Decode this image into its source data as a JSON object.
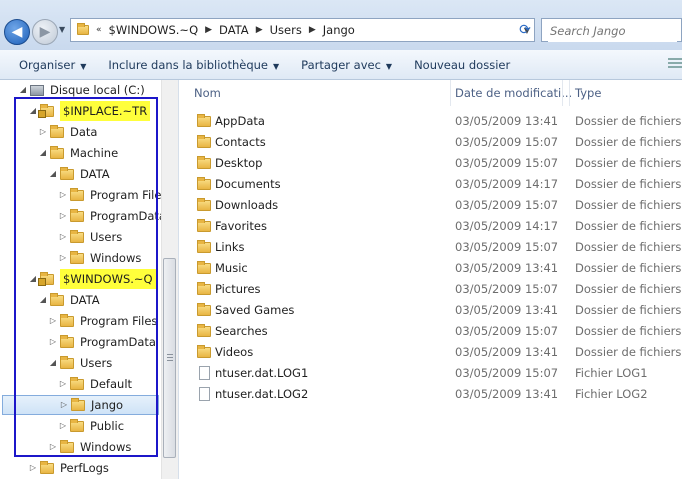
{
  "address": {
    "overflow": "«",
    "crumbs": [
      "$WINDOWS.~Q",
      "DATA",
      "Users",
      "Jango"
    ]
  },
  "search": {
    "placeholder": "Search Jango"
  },
  "toolbar": {
    "organize": "Organiser",
    "library": "Inclure dans la bibliothèque",
    "share": "Partager avec",
    "new_folder": "Nouveau dossier"
  },
  "tree": [
    {
      "label": "Disque local (C:)",
      "kind": "drive",
      "expanded": true
    },
    {
      "label": "$INPLACE.~TR",
      "kind": "locked",
      "expanded": true,
      "highlight": true
    },
    {
      "label": "Data",
      "kind": "folder",
      "expanded": false
    },
    {
      "label": "Machine",
      "kind": "folder",
      "expanded": true
    },
    {
      "label": "DATA",
      "kind": "folder",
      "expanded": true
    },
    {
      "label": "Program Files",
      "kind": "folder",
      "expanded": false
    },
    {
      "label": "ProgramData",
      "kind": "folder",
      "expanded": false
    },
    {
      "label": "Users",
      "kind": "folder",
      "expanded": false
    },
    {
      "label": "Windows",
      "kind": "folder",
      "expanded": false
    },
    {
      "label": "$WINDOWS.~Q",
      "kind": "locked",
      "expanded": true,
      "highlight": true
    },
    {
      "label": "DATA",
      "kind": "folder",
      "expanded": true
    },
    {
      "label": "Program Files",
      "kind": "folder",
      "expanded": false
    },
    {
      "label": "ProgramData",
      "kind": "folder",
      "expanded": false
    },
    {
      "label": "Users",
      "kind": "folder",
      "expanded": true
    },
    {
      "label": "Default",
      "kind": "folder",
      "expanded": false
    },
    {
      "label": "Jango",
      "kind": "folder",
      "expanded": false,
      "selected": true
    },
    {
      "label": "Public",
      "kind": "folder",
      "expanded": false
    },
    {
      "label": "Windows",
      "kind": "folder",
      "expanded": false
    },
    {
      "label": "PerfLogs",
      "kind": "folder",
      "expanded": false
    }
  ],
  "columns": {
    "name": "Nom",
    "date": "Date de modificati...",
    "type": "Type"
  },
  "files": [
    {
      "name": "AppData",
      "date": "03/05/2009 13:41",
      "type": "Dossier de fichiers",
      "icon": "folder"
    },
    {
      "name": "Contacts",
      "date": "03/05/2009 15:07",
      "type": "Dossier de fichiers",
      "icon": "folder"
    },
    {
      "name": "Desktop",
      "date": "03/05/2009 15:07",
      "type": "Dossier de fichiers",
      "icon": "folder"
    },
    {
      "name": "Documents",
      "date": "03/05/2009 14:17",
      "type": "Dossier de fichiers",
      "icon": "folder"
    },
    {
      "name": "Downloads",
      "date": "03/05/2009 15:07",
      "type": "Dossier de fichiers",
      "icon": "folder"
    },
    {
      "name": "Favorites",
      "date": "03/05/2009 14:17",
      "type": "Dossier de fichiers",
      "icon": "folder"
    },
    {
      "name": "Links",
      "date": "03/05/2009 15:07",
      "type": "Dossier de fichiers",
      "icon": "folder"
    },
    {
      "name": "Music",
      "date": "03/05/2009 13:41",
      "type": "Dossier de fichiers",
      "icon": "folder"
    },
    {
      "name": "Pictures",
      "date": "03/05/2009 15:07",
      "type": "Dossier de fichiers",
      "icon": "folder"
    },
    {
      "name": "Saved Games",
      "date": "03/05/2009 13:41",
      "type": "Dossier de fichiers",
      "icon": "folder"
    },
    {
      "name": "Searches",
      "date": "03/05/2009 15:07",
      "type": "Dossier de fichiers",
      "icon": "folder"
    },
    {
      "name": "Videos",
      "date": "03/05/2009 13:41",
      "type": "Dossier de fichiers",
      "icon": "folder"
    },
    {
      "name": "ntuser.dat.LOG1",
      "date": "03/05/2009 15:07",
      "type": "Fichier LOG1",
      "icon": "file"
    },
    {
      "name": "ntuser.dat.LOG2",
      "date": "03/05/2009 13:41",
      "type": "Fichier LOG2",
      "icon": "file"
    }
  ],
  "colors": {
    "highlight": "#ffff3b",
    "annotation_box": "#1c16c9"
  }
}
